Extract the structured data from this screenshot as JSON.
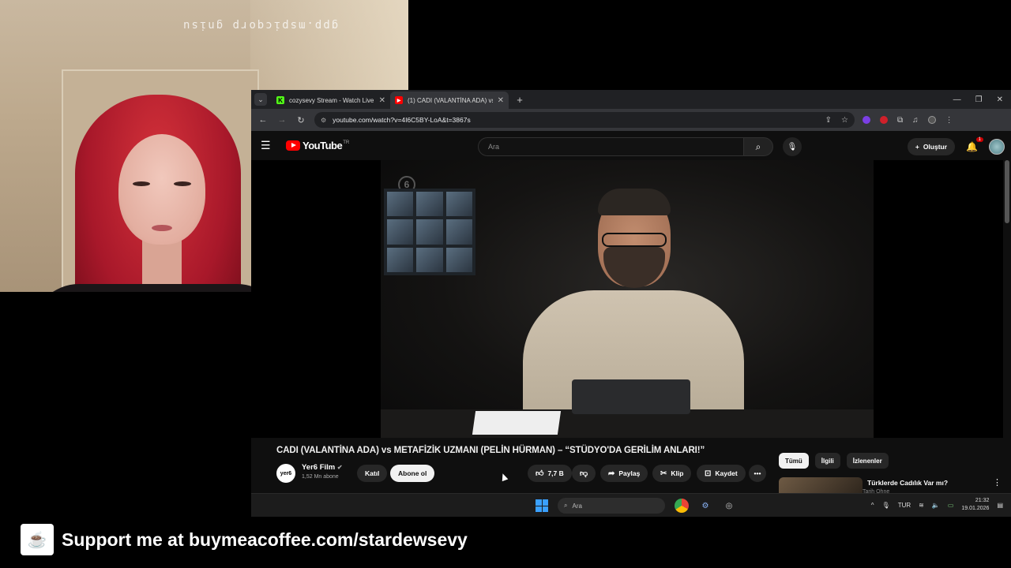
{
  "webcam": {
    "watermark": "gpp.mspicqorp gnisu"
  },
  "browser": {
    "tabs": [
      {
        "label": "cozysevy Stream - Watch Live o",
        "fav": "K",
        "fav_color": "#53fc18"
      },
      {
        "label": "(1) CADI (VALANTİNA ADA) vs M",
        "fav": "▶",
        "fav_color": "#ff0000"
      }
    ],
    "new_tab": "+",
    "url": "youtube.com/watch?v=4I6C5BY-LoA&t=3867s"
  },
  "youtube": {
    "logo_text": "YouTube",
    "region": "TR",
    "search_placeholder": "Ara",
    "create_label": "Oluştur",
    "notif_count": "1",
    "video_title": "CADI (VALANTİNA ADA) vs METAFİZİK UZMANI (PELİN HÜRMAN) – “STÜDYO'DA GERİLİM ANLARI!”",
    "channel": {
      "logo": "yer6",
      "name": "Yer6 Film",
      "subs": "1,52 Mn abone"
    },
    "join_label": "Katıl",
    "subscribe_label": "Abone ol",
    "like_count": "7,7 B",
    "share_label": "Paylaş",
    "clip_label": "Klip",
    "save_label": "Kaydet",
    "chips": [
      "Tümü",
      "İlgili",
      "İzlenenler"
    ],
    "rec": {
      "title": "Türklerde Cadılık Var mı?",
      "sub": "Tarih Ohne"
    }
  },
  "taskbar": {
    "search_label": "Ara",
    "lang": "TUR",
    "time": "21:32",
    "date": "19.01.2026"
  },
  "banner": {
    "text": "Support me at buymeacoffee.com/stardewsevy"
  }
}
